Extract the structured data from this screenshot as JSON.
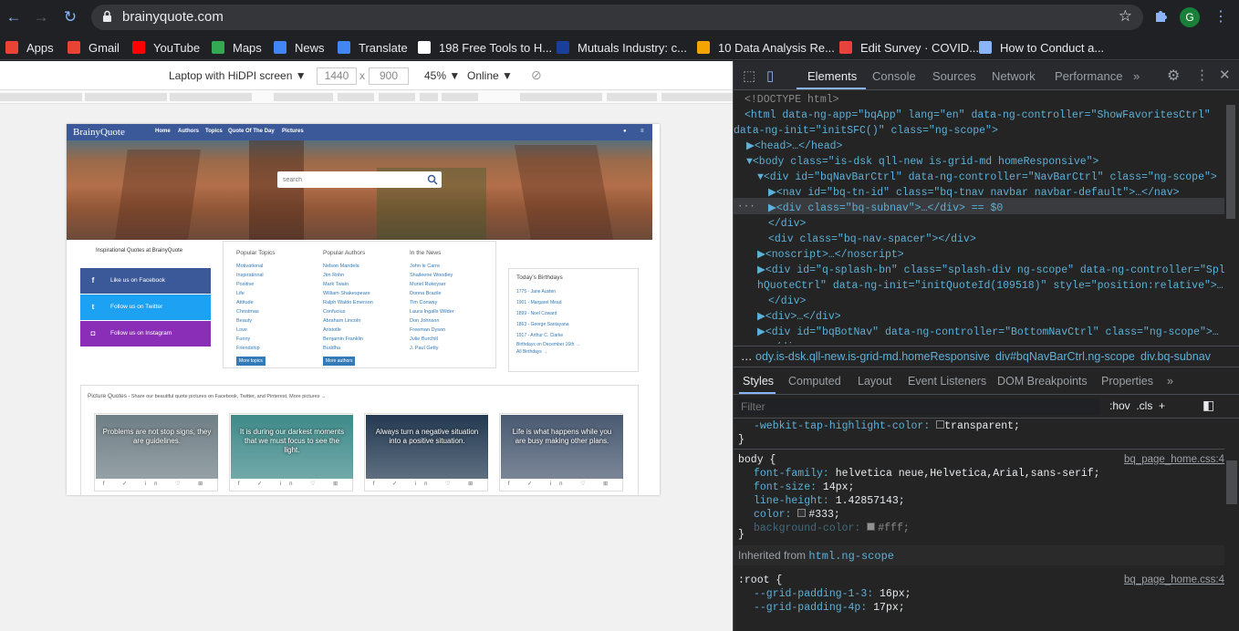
{
  "browser": {
    "url": "brainyquote.com",
    "profile_initial": "G",
    "bookmarks": [
      {
        "label": "Apps",
        "icon": "apps-grid-icon",
        "color": "#ea4335"
      },
      {
        "label": "Gmail",
        "icon": "gmail-icon",
        "color": "#ea4335"
      },
      {
        "label": "YouTube",
        "icon": "youtube-icon",
        "color": "#ff0000"
      },
      {
        "label": "Maps",
        "icon": "maps-pin-icon",
        "color": "#34a853"
      },
      {
        "label": "News",
        "icon": "news-icon",
        "color": "#4285f4"
      },
      {
        "label": "Translate",
        "icon": "translate-icon",
        "color": "#4285f4"
      },
      {
        "label": "198 Free Tools to H...",
        "icon": "e-icon",
        "color": "#ffffff"
      },
      {
        "label": "Mutuals Industry: c...",
        "icon": "square-icon",
        "color": "#1a3f9b"
      },
      {
        "label": "10 Data Analysis Re...",
        "icon": "ex-icon",
        "color": "#f4a300"
      },
      {
        "label": "Edit Survey · COVID...",
        "icon": "tt-icon",
        "color": "#e8423c"
      },
      {
        "label": "How to Conduct a...",
        "icon": "accessibility-icon",
        "color": "#8ab4f8"
      }
    ]
  },
  "device_toolbar": {
    "device": "Laptop with HiDPI screen ▼",
    "width": "1440",
    "x": "x",
    "height": "900",
    "zoom": "45% ▼",
    "network": "Online ▼"
  },
  "site": {
    "logo": "BrainyQuote",
    "nav": [
      "Home",
      "Authors",
      "Topics",
      "Quote Of The Day",
      "Pictures"
    ],
    "search_placeholder": "search",
    "left_title": "Inspirational Quotes at BrainyQuote",
    "social": [
      {
        "label": "Like us on Facebook",
        "glyph": "f",
        "color": "#3b5998"
      },
      {
        "label": "Follow us on Twitter",
        "glyph": "t",
        "color": "#1da1f2"
      },
      {
        "label": "Follow us on Instagram",
        "glyph": "◘",
        "color": "#8a2eb8"
      }
    ],
    "popular_topics": {
      "title": "Popular Topics",
      "items": [
        "Motivational",
        "Inspirational",
        "Positive",
        "Life",
        "Attitude",
        "Christmas",
        "Beauty",
        "Love",
        "Funny",
        "Friendship"
      ],
      "more": "More topics"
    },
    "popular_authors": {
      "title": "Popular Authors",
      "items": [
        "Nelson Mandela",
        "Jim Rohn",
        "Mark Twain",
        "William Shakespeare",
        "Ralph Waldo Emerson",
        "Confucius",
        "Abraham Lincoln",
        "Aristotle",
        "Benjamin Franklin",
        "Buddha"
      ],
      "more": "More authors"
    },
    "in_the_news": {
      "title": "In the News",
      "items": [
        "John le Carre",
        "Shaileene Woodley",
        "Muriel Rukeyser",
        "Donna Brazile",
        "Tim Conway",
        "Laura Ingalls Wilder",
        "Don Johnson",
        "Freeman Dyson",
        "Julie Burchill",
        "J. Paul Getty"
      ]
    },
    "birthdays": {
      "title": "Today's Birthdays",
      "items": [
        "1775 - Jane Austen",
        "1901 - Margaret Mead",
        "1899 - Noel Coward",
        "1863 - George Santayana",
        "1917 - Arthur C. Clarke"
      ],
      "footer1": "Birthdays on December 16th →",
      "footer2": "All Birthdays →"
    },
    "picture_quotes": {
      "title": "Picture Quotes",
      "subtitle": " - Share our beautiful quote pictures on Facebook, Twitter, and Pinterest. More pictures →",
      "cards": [
        {
          "text": "Problems are not stop signs, they are guidelines.",
          "bg": "#6f7f86"
        },
        {
          "text": "It is during our darkest moments that we must focus to see the light.",
          "bg": "#3f8a8a"
        },
        {
          "text": "Always turn a negative situation into a positive situation.",
          "bg": "#243a52"
        },
        {
          "text": "Life is what happens while you are busy making other plans.",
          "bg": "#4a5a72"
        }
      ],
      "card_icons": "f ✓ in ♡ ⊞"
    }
  },
  "devtools": {
    "tabs": [
      "Elements",
      "Console",
      "Sources",
      "Network",
      "Performance",
      "»"
    ],
    "dom_lines": [
      {
        "t": "<!DOCTYPE html>",
        "cls": "cm",
        "indent": 12
      },
      {
        "t": "<html data-ng-app=\"bqApp\" lang=\"en\" data-ng-controller=\"ShowFavoritesCtrl\"",
        "cls": "tag",
        "indent": 12
      },
      {
        "t": "data-ng-init=\"initSFC()\" class=\"ng-scope\">",
        "cls": "tag",
        "indent": 0
      },
      {
        "t": "▶<head>…</head>",
        "cls": "tag",
        "indent": 14
      },
      {
        "t": "▼<body class=\"is-dsk qll-new is-grid-md homeResponsive\">",
        "cls": "tag",
        "indent": 14
      },
      {
        "t": "▼<div id=\"bqNavBarCtrl\" data-ng-controller=\"NavBarCtrl\" class=\"ng-scope\">",
        "cls": "tag",
        "indent": 26
      },
      {
        "t": "▶<nav id=\"bq-tn-id\" class=\"bq-tnav navbar navbar-default\">…</nav>",
        "cls": "tag",
        "indent": 38
      },
      {
        "t": "▶<div class=\"bq-subnav\">…</div> == $0",
        "cls": "tag",
        "indent": 38
      },
      {
        "t": "</div>",
        "cls": "tag",
        "indent": 38
      },
      {
        "t": "<div class=\"bq-nav-spacer\"></div>",
        "cls": "tag",
        "indent": 38
      },
      {
        "t": "▶<noscript>…</noscript>",
        "cls": "tag",
        "indent": 26
      },
      {
        "t": "▶<div id=\"q-splash-bn\" class=\"splash-div ng-scope\" data-ng-controller=\"Splas",
        "cls": "tag",
        "indent": 26
      },
      {
        "t": "hQuoteCtrl\" data-ng-init=\"initQuoteId(109518)\" style=\"position:relative\">…",
        "cls": "tag",
        "indent": 26
      },
      {
        "t": "</div>",
        "cls": "tag",
        "indent": 38
      },
      {
        "t": "▶<div>…</div>",
        "cls": "tag",
        "indent": 26
      },
      {
        "t": "▶<div id=\"bqBotNav\" data-ng-controller=\"BottomNavCtrl\" class=\"ng-scope\">…",
        "cls": "tag",
        "indent": 26
      },
      {
        "t": "</div>",
        "cls": "tag",
        "indent": 38
      }
    ],
    "breadcrumbs": [
      "…",
      "ody.is-dsk.qll-new.is-grid-md.homeResponsive",
      "div#bqNavBarCtrl.ng-scope",
      "div.bq-subnav"
    ],
    "styles_tabs": [
      "Styles",
      "Computed",
      "Layout",
      "Event Listeners",
      "DOM Breakpoints",
      "Properties",
      "»"
    ],
    "filter_placeholder": "Filter",
    "filter_tools": ":hov  .cls  +",
    "rules": {
      "prev_prop": "-webkit-tap-highlight-color:",
      "prev_val": "transparent;",
      "body_selector": "body {",
      "body_source": "bq_page_home.css:4",
      "body_props": [
        {
          "p": "font-family:",
          "v": "helvetica neue,Helvetica,Arial,sans-serif;"
        },
        {
          "p": "font-size:",
          "v": "14px;"
        },
        {
          "p": "line-height:",
          "v": "1.42857143;"
        },
        {
          "p": "color:",
          "v": "#333;"
        },
        {
          "p": "background-color:",
          "v": "#fff;"
        }
      ],
      "inherited_label": "Inherited from ",
      "inherited_from": "html.ng-scope",
      "root_selector": ":root {",
      "root_source": "bq_page_home.css:4",
      "root_props": [
        {
          "p": "--grid-padding-1-3:",
          "v": "16px;"
        },
        {
          "p": "--grid-padding-4p:",
          "v": "17px;"
        }
      ]
    }
  }
}
